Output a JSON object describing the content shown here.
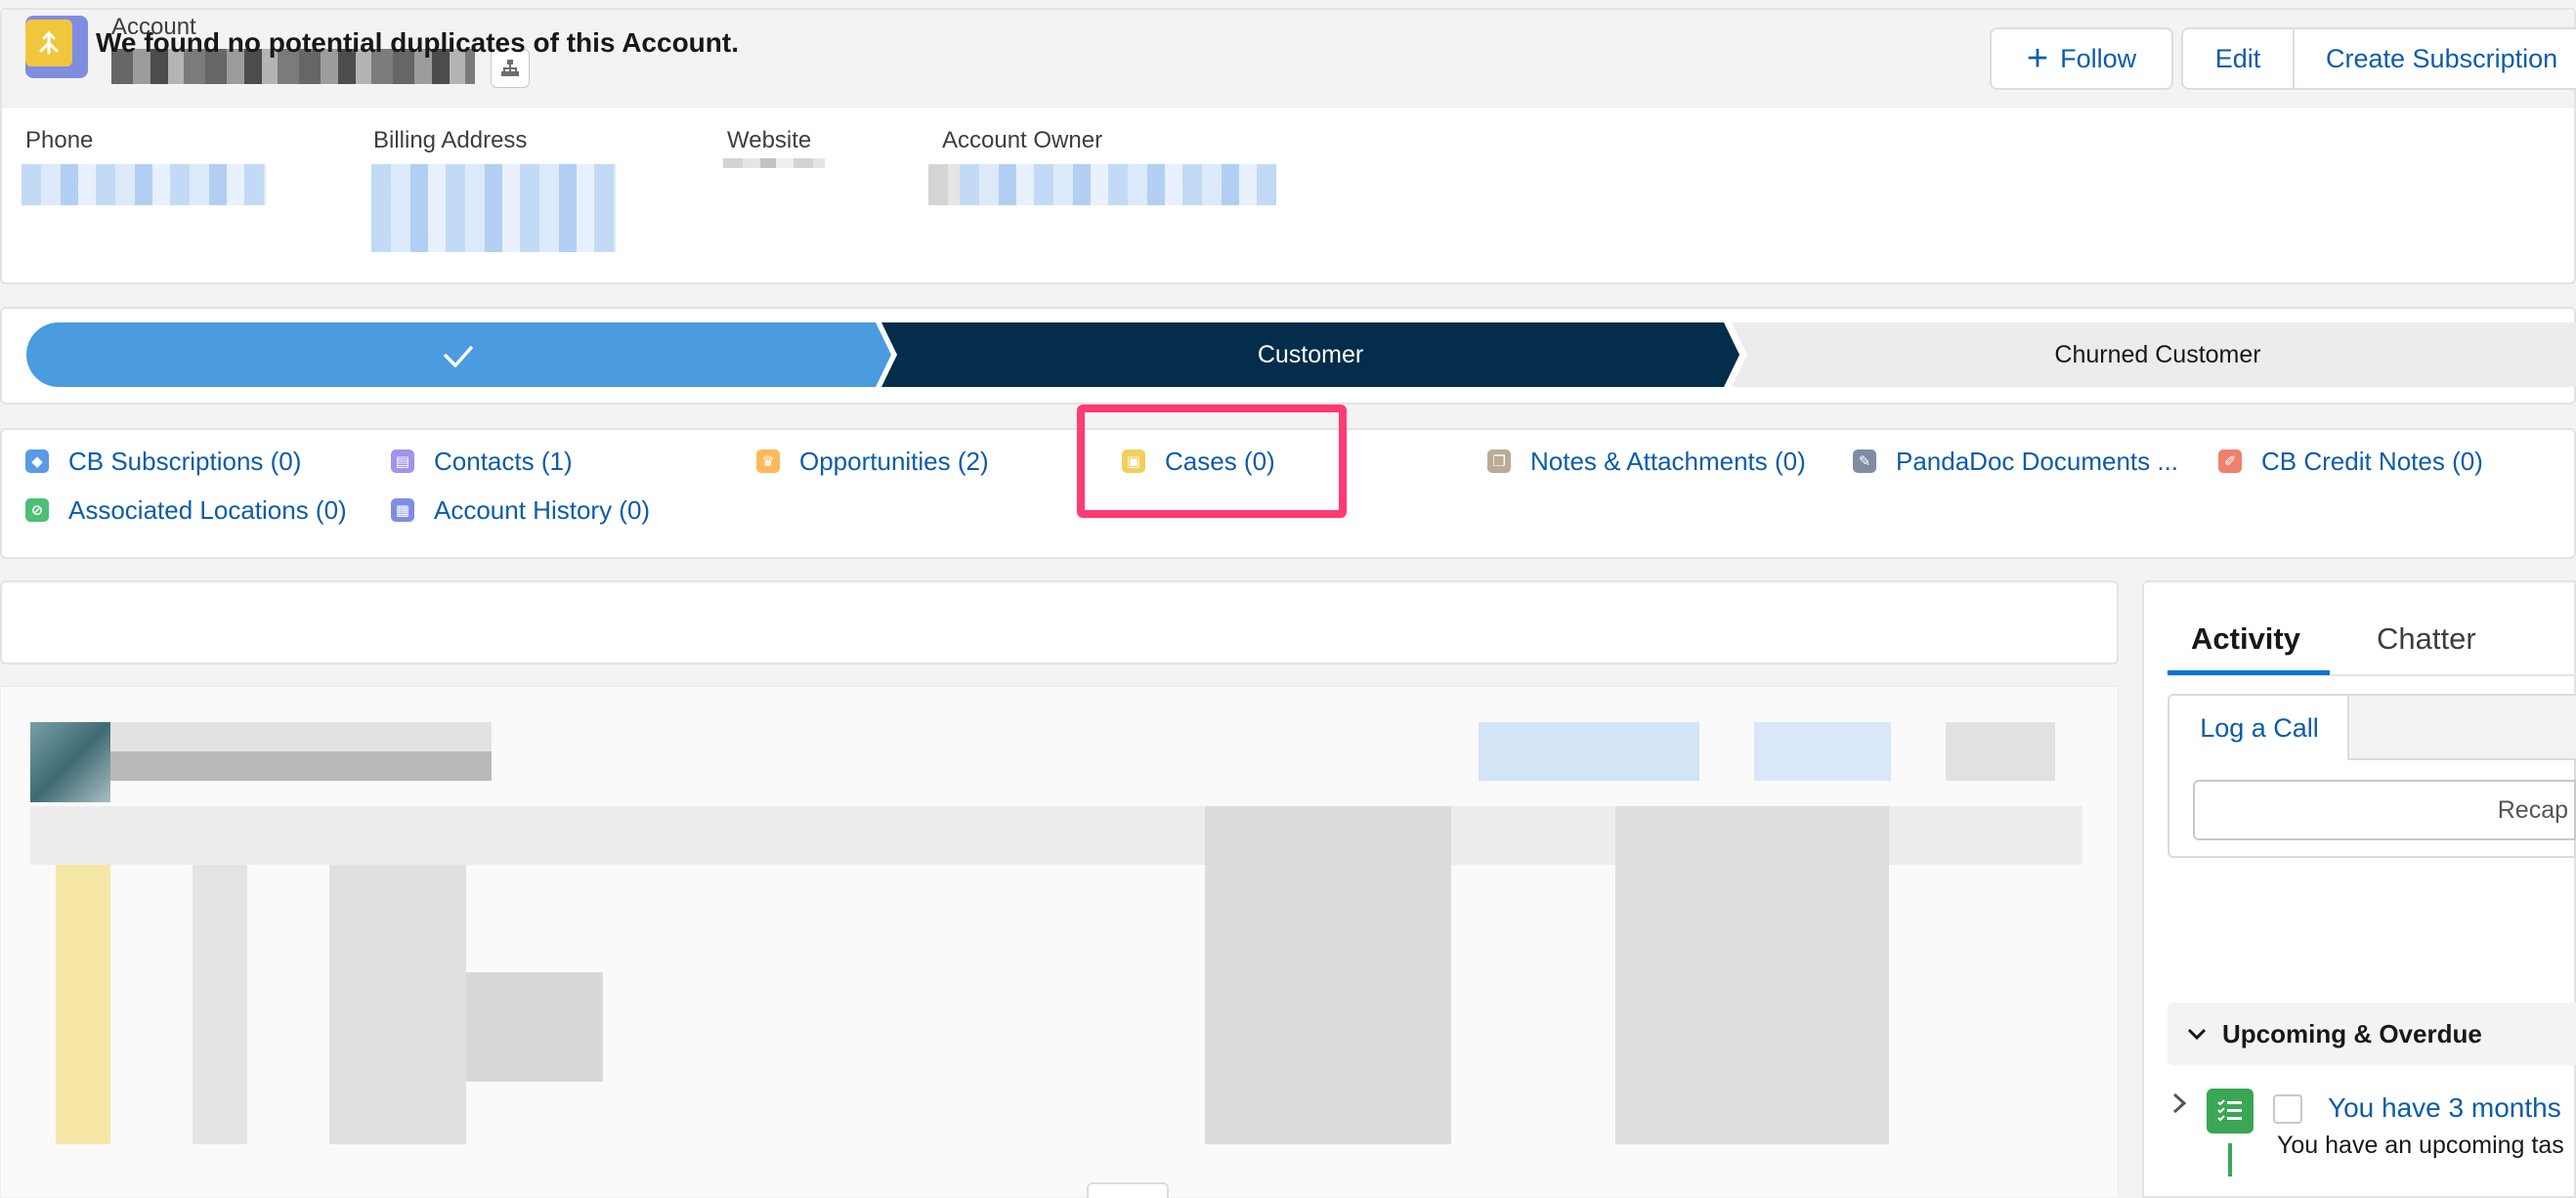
{
  "header": {
    "entity_label": "Account",
    "follow_label": "Follow",
    "edit_label": "Edit",
    "create_subscription_label": "Create Subscription"
  },
  "fields": {
    "phone_label": "Phone",
    "billing_address_label": "Billing Address",
    "website_label": "Website",
    "account_owner_label": "Account Owner"
  },
  "path": {
    "stages": [
      {
        "label": "",
        "state": "complete"
      },
      {
        "label": "Customer",
        "state": "current"
      },
      {
        "label": "Churned Customer",
        "state": "incomplete"
      }
    ]
  },
  "related_links": [
    {
      "label": "CB Subscriptions (0)",
      "icon": "cube-icon",
      "color": "#5a9ae6"
    },
    {
      "label": "Contacts (1)",
      "icon": "contact-card-icon",
      "color": "#a094ed"
    },
    {
      "label": "Opportunities (2)",
      "icon": "crown-icon",
      "color": "#fcb95b"
    },
    {
      "label": "Cases (0)",
      "icon": "briefcase-icon",
      "color": "#f2cf5b"
    },
    {
      "label": "Notes & Attachments (0)",
      "icon": "document-icon",
      "color": "#baac93"
    },
    {
      "label": "PandaDoc Documents ...",
      "icon": "wrench-icon",
      "color": "#7f8ca1"
    },
    {
      "label": "CB Credit Notes (0)",
      "icon": "pencil-icon",
      "color": "#f0806e"
    },
    {
      "label": "Associated Locations (0)",
      "icon": "location-icon",
      "color": "#4bc076"
    },
    {
      "label": "Account History (0)",
      "icon": "history-icon",
      "color": "#7f8de1"
    }
  ],
  "duplicates": {
    "message": "We found no potential duplicates of this Account."
  },
  "activity": {
    "tab_activity": "Activity",
    "tab_chatter": "Chatter",
    "log_call_label": "Log a Call",
    "recap_placeholder": "Recap",
    "upcoming_label": "Upcoming & Overdue",
    "task_title": "You have 3 months",
    "task_subtitle": "You have an upcoming tas"
  },
  "colors": {
    "brand_blue": "#0176d3",
    "path_complete": "#4a9be0",
    "path_current": "#032d4a",
    "highlight": "#ff3b74"
  }
}
